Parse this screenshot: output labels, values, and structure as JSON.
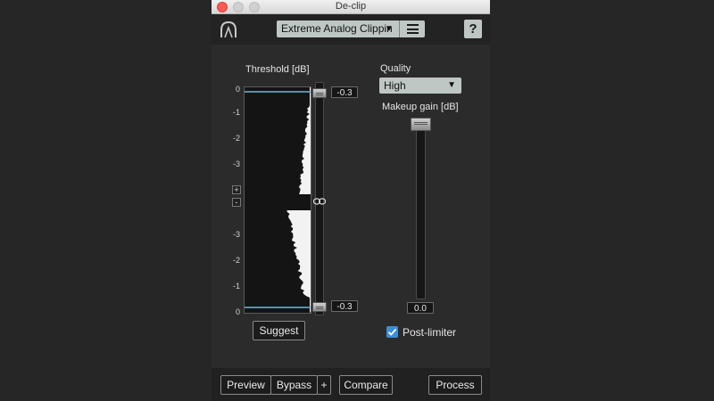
{
  "window": {
    "title": "De-clip"
  },
  "header": {
    "logo_icon": "izotope-arch-icon",
    "preset_name": "Extreme Analog Clippin",
    "preset_arrow": "▼",
    "menu_icon": "hamburger-menu-icon",
    "help_label": "?"
  },
  "threshold": {
    "label": "Threshold [dB]",
    "ticks_top": [
      "0",
      "-1",
      "-2",
      "-3"
    ],
    "ticks_bottom": [
      "-3",
      "-2",
      "-1",
      "0"
    ],
    "top_value": "-0.3",
    "bottom_value": "-0.3",
    "plus_label": "+",
    "minus_label": "-",
    "link_icon": "link-chain-icon",
    "suggest_label": "Suggest"
  },
  "quality": {
    "label": "Quality",
    "selected": "High",
    "arrow": "▼"
  },
  "makeup": {
    "label": "Makeup gain [dB]",
    "value": "0.0"
  },
  "post_limiter": {
    "label": "Post-limiter",
    "checked": true
  },
  "footer": {
    "preview_label": "Preview",
    "bypass_label": "Bypass",
    "plus_label": "+",
    "compare_label": "Compare",
    "process_label": "Process"
  },
  "colors": {
    "accent_blue": "#3b8fd8",
    "threshold_line": "#6fb8d6",
    "control_gray": "#bfc7c5"
  }
}
